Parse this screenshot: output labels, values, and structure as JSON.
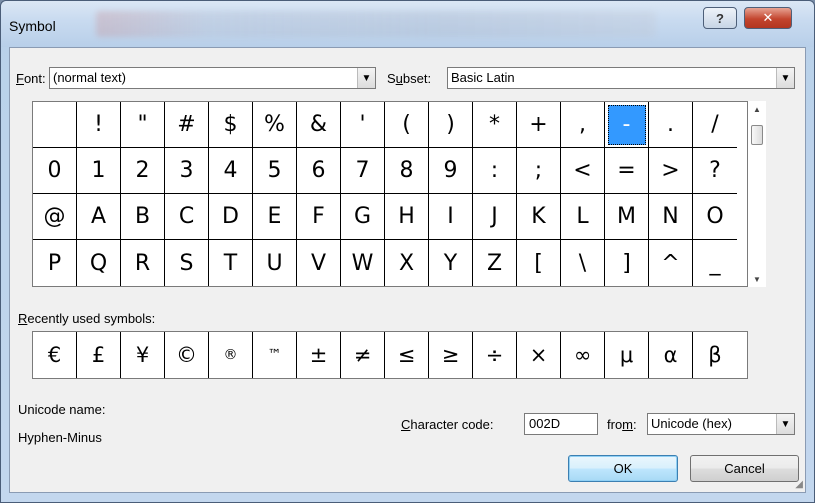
{
  "window": {
    "title": "Symbol",
    "help_label": "?",
    "close_label": "✕"
  },
  "font": {
    "label_prefix": "",
    "label_hotkey": "F",
    "label_rest": "ont:",
    "value": "(normal text)"
  },
  "subset": {
    "label_prefix": "S",
    "label_hotkey": "u",
    "label_rest": "bset:",
    "value": "Basic Latin"
  },
  "symbols": [
    [
      "",
      "!",
      "\"",
      "#",
      "$",
      "%",
      "&",
      "'",
      "(",
      ")",
      "*",
      "+",
      ",",
      "-",
      ".",
      "/"
    ],
    [
      "0",
      "1",
      "2",
      "3",
      "4",
      "5",
      "6",
      "7",
      "8",
      "9",
      ":",
      ";",
      "<",
      "=",
      ">",
      "?"
    ],
    [
      "@",
      "A",
      "B",
      "C",
      "D",
      "E",
      "F",
      "G",
      "H",
      "I",
      "J",
      "K",
      "L",
      "M",
      "N",
      "O"
    ],
    [
      "P",
      "Q",
      "R",
      "S",
      "T",
      "U",
      "V",
      "W",
      "X",
      "Y",
      "Z",
      "[",
      "\\",
      "]",
      "^",
      "_"
    ]
  ],
  "selected_symbol": "-",
  "recent": {
    "label_hotkey": "R",
    "label_rest": "ecently used symbols:",
    "symbols": [
      "€",
      "£",
      "¥",
      "©",
      "®",
      "™",
      "±",
      "≠",
      "≤",
      "≥",
      "÷",
      "×",
      "∞",
      "μ",
      "α",
      "β"
    ]
  },
  "unicode_name": {
    "label": "Unicode name:",
    "value": "Hyphen-Minus"
  },
  "char_code": {
    "label_hotkey": "C",
    "label_rest": "haracter code:",
    "value": "002D"
  },
  "from": {
    "label_prefix": "fro",
    "label_hotkey": "m",
    "label_rest": ":",
    "value": "Unicode (hex)"
  },
  "buttons": {
    "ok": "OK",
    "cancel": "Cancel"
  },
  "icons": {
    "dropdown": "chevron-down-icon",
    "scroll_up": "scroll-up-icon",
    "scroll_down": "scroll-down-icon"
  }
}
